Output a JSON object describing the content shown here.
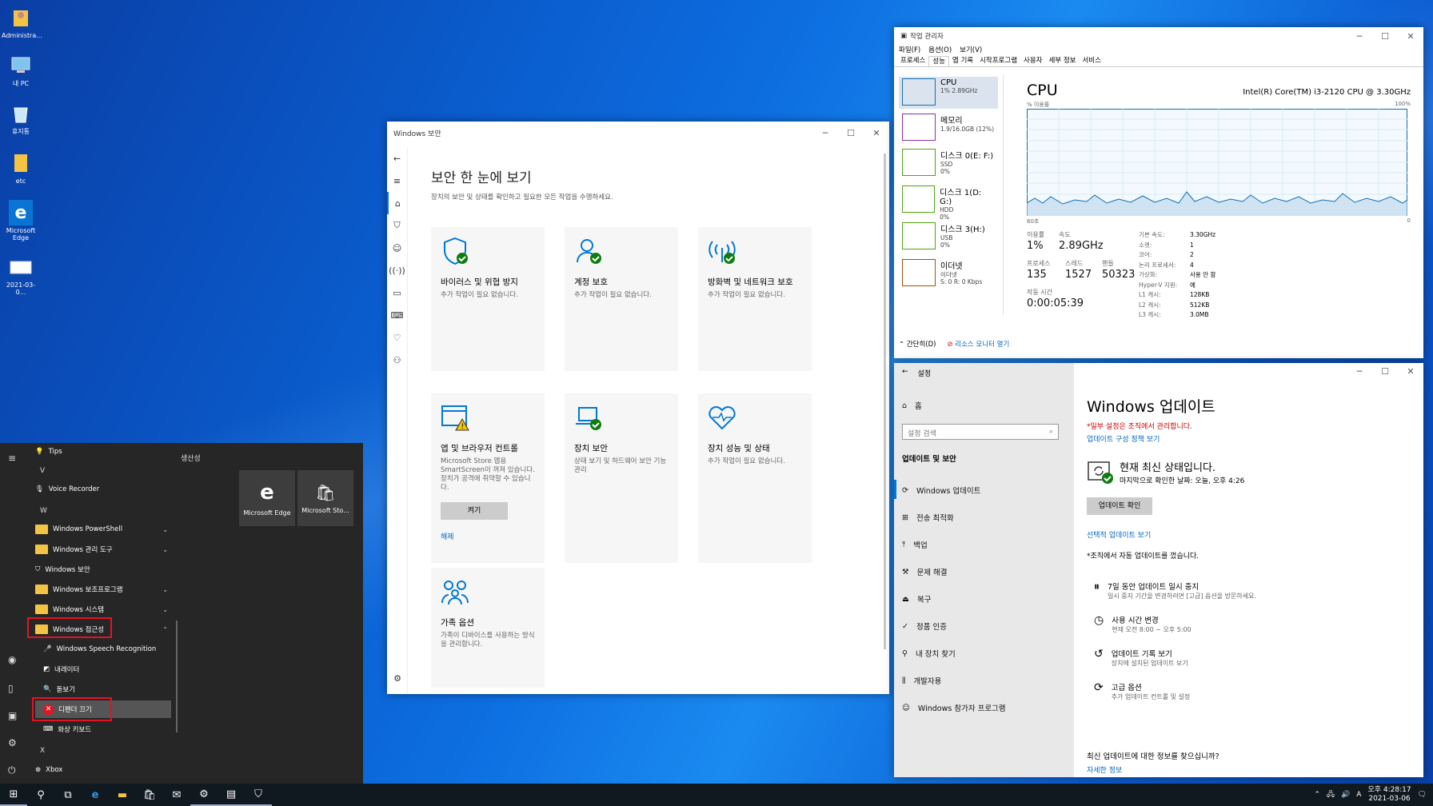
{
  "desktop": {
    "icons": [
      "Administra...",
      "내 PC",
      "휴지통",
      "etc",
      "Microsoft Edge",
      "2021-03-0..."
    ]
  },
  "security": {
    "title": "Windows 보안",
    "heading": "보안 한 눈에 보기",
    "subheading": "장치의 보안 및 상태를 확인하고 필요한 모든 작업을 수행하세요.",
    "cards": [
      {
        "title": "바이러스 및 위협 방지",
        "desc": "추가 작업이 필요 없습니다."
      },
      {
        "title": "계정 보호",
        "desc": "추가 작업이 필요 없습니다."
      },
      {
        "title": "방화벽 및 네트워크 보호",
        "desc": "추가 작업이 필요 없습니다."
      },
      {
        "title": "앱 및 브라우저 컨트롤",
        "desc": "Microsoft Store 앱용 SmartScreen이 꺼져 있습니다. 장치가 공격에 취약할 수 있습니다.",
        "button": "켜기",
        "link": "해제"
      },
      {
        "title": "장치 보안",
        "desc": "상태 보기 및 하드웨어 보안 기능 관리"
      },
      {
        "title": "장치 성능 및 상태",
        "desc": "추가 작업이 필요 없습니다."
      },
      {
        "title": "가족 옵션",
        "desc": "가족이 디바이스를 사용하는 방식을 관리합니다."
      }
    ]
  },
  "taskmgr": {
    "title": "작업 관리자",
    "menu": [
      "파일(F)",
      "옵션(O)",
      "보기(V)"
    ],
    "tabs": [
      "프로세스",
      "성능",
      "앱 기록",
      "시작프로그램",
      "사용자",
      "세부 정보",
      "서비스"
    ],
    "side": [
      {
        "name": "CPU",
        "sub1": "1% 2.89GHz",
        "sub2": "",
        "sub3": ""
      },
      {
        "name": "메모리",
        "sub1": "1.9/16.0GB (12%)",
        "sub2": "",
        "sub3": ""
      },
      {
        "name": "디스크 0(E: F:)",
        "sub1": "SSD",
        "sub2": "0%",
        "sub3": ""
      },
      {
        "name": "디스크 1(D: G:)",
        "sub1": "HDD",
        "sub2": "0%",
        "sub3": ""
      },
      {
        "name": "디스크 3(H:)",
        "sub1": "USB",
        "sub2": "0%",
        "sub3": ""
      },
      {
        "name": "이더넷",
        "sub1": "이더넷",
        "sub2": "S: 0 R: 0 Kbps",
        "sub3": ""
      }
    ],
    "cpu": {
      "heading": "CPU",
      "model": "Intel(R) Core(TM) i3-2120 CPU @ 3.30GHz",
      "y_label": "% 이용률",
      "y_max": "100%",
      "x_left": "60초",
      "x_right": "0",
      "util_label": "이용률",
      "util": "1%",
      "speed_label": "속도",
      "speed": "2.89GHz",
      "proc_label": "프로세스",
      "proc": "135",
      "thread_label": "스레드",
      "thread": "1527",
      "handle_label": "핸들",
      "handle": "50323",
      "uptime_label": "작동 시간",
      "uptime": "0:00:05:39",
      "specs": [
        [
          "기본 속도:",
          "3.30GHz"
        ],
        [
          "소켓:",
          "1"
        ],
        [
          "코어:",
          "2"
        ],
        [
          "논리 프로세서:",
          "4"
        ],
        [
          "가상화:",
          "사용 안 함"
        ],
        [
          "Hyper-V 지원:",
          "예"
        ],
        [
          "L1 캐시:",
          "128KB"
        ],
        [
          "L2 캐시:",
          "512KB"
        ],
        [
          "L3 캐시:",
          "3.0MB"
        ]
      ]
    },
    "footer_brief": "간단히(D)",
    "footer_monitor": "리소스 모니터 열기"
  },
  "settings": {
    "title": "설정",
    "home": "홈",
    "search_placeholder": "설정 검색",
    "section": "업데이트 및 보안",
    "nav": [
      "Windows 업데이트",
      "전송 최적화",
      "백업",
      "문제 해결",
      "복구",
      "정품 인증",
      "내 장치 찾기",
      "개발자용",
      "Windows 참가자 프로그램"
    ],
    "heading": "Windows 업데이트",
    "managed": "*일부 설정은 조직에서 관리합니다.",
    "policy_link": "업데이트 구성 정책 보기",
    "status": "현재 최신 상태입니다.",
    "last_check": "마지막으로 확인한 날짜: 오늘, 오후 4:26",
    "check_button": "업데이트 확인",
    "optional_link": "선택적 업데이트 보기",
    "auto_off": "*조직에서 자동 업데이트를 껐습니다.",
    "options": [
      {
        "title": "7일 동안 업데이트 일시 중지",
        "desc": "일시 중지 기간을 변경하려면 [고급] 옵션을 방문하세요."
      },
      {
        "title": "사용 시간 변경",
        "desc": "현재 오전 8:00 ~ 오후 5:00"
      },
      {
        "title": "업데이트 기록 보기",
        "desc": "장치에 설치된 업데이트 보기"
      },
      {
        "title": "고급 옵션",
        "desc": "추가 업데이트 컨트롤 및 설정"
      }
    ],
    "bottom_q": "최신 업데이트에 대한 정보를 찾으십니까?",
    "bottom_link": "자세한 정보"
  },
  "start": {
    "group": "생산성",
    "items": [
      "Tips",
      "V",
      "Voice Recorder",
      "W",
      "Windows PowerShell",
      "Windows 관리 도구",
      "Windows 보안",
      "Windows 보조프로그램",
      "Windows 시스템",
      "Windows 접근성",
      "Windows Speech Recognition",
      "내레이터",
      "돋보기",
      "디펜더 끄기",
      "화상 키보드",
      "X",
      "Xbox"
    ],
    "tiles": [
      "Microsoft Edge",
      "Microsoft Sto..."
    ]
  },
  "taskbar": {
    "time": "오후 4:28:17",
    "date": "2021-03-06",
    "ime": "A"
  },
  "colors": {
    "accent": "#0078d7",
    "green": "#107c10",
    "red": "#e81123",
    "highlight": "#e81123"
  }
}
